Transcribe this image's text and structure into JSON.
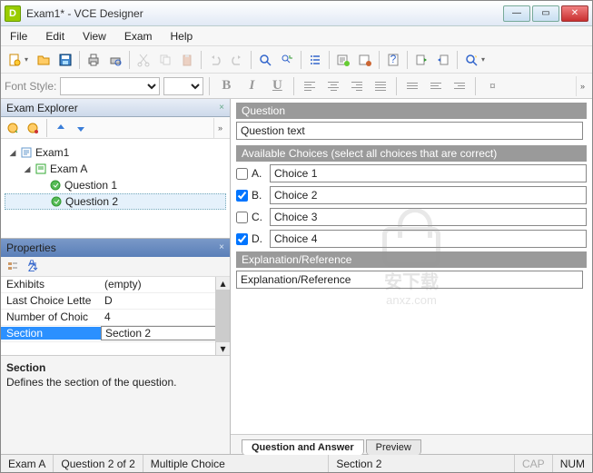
{
  "window": {
    "title": "Exam1* - VCE Designer"
  },
  "menu": {
    "file": "File",
    "edit": "Edit",
    "view": "View",
    "exam": "Exam",
    "help": "Help"
  },
  "fontbar": {
    "label": "Font Style:",
    "bold": "B",
    "italic": "I",
    "underline": "U"
  },
  "explorer": {
    "title": "Exam Explorer",
    "root": "Exam1",
    "section": "Exam A",
    "q1": "Question 1",
    "q2": "Question 2"
  },
  "properties": {
    "title": "Properties",
    "rows": {
      "exhibits": {
        "name": "Exhibits",
        "value": "(empty)"
      },
      "lastchoice": {
        "name": "Last Choice Lette",
        "value": "D"
      },
      "numchoice": {
        "name": "Number of Choic",
        "value": "4"
      },
      "section": {
        "name": "Section",
        "value": "Section 2"
      }
    },
    "desc": {
      "title": "Section",
      "body": "Defines the section of the question."
    }
  },
  "editor": {
    "question_hdr": "Question",
    "question_text": "Question text",
    "choices_hdr": "Available Choices (select all choices that are correct)",
    "choices": [
      {
        "label": "A.",
        "text": "Choice 1",
        "checked": false
      },
      {
        "label": "B.",
        "text": "Choice 2",
        "checked": true
      },
      {
        "label": "C.",
        "text": "Choice 3",
        "checked": false
      },
      {
        "label": "D.",
        "text": "Choice 4",
        "checked": true
      }
    ],
    "explain_hdr": "Explanation/Reference",
    "explain_text": "Explanation/Reference"
  },
  "tabs": {
    "qa": "Question and Answer",
    "preview": "Preview"
  },
  "status": {
    "exam": "Exam A",
    "qpos": "Question 2 of 2",
    "type": "Multiple Choice",
    "sect": "Section 2",
    "cap": "CAP",
    "num": "NUM"
  },
  "watermark": {
    "t1": "安下载",
    "t2": "anxz.com"
  }
}
